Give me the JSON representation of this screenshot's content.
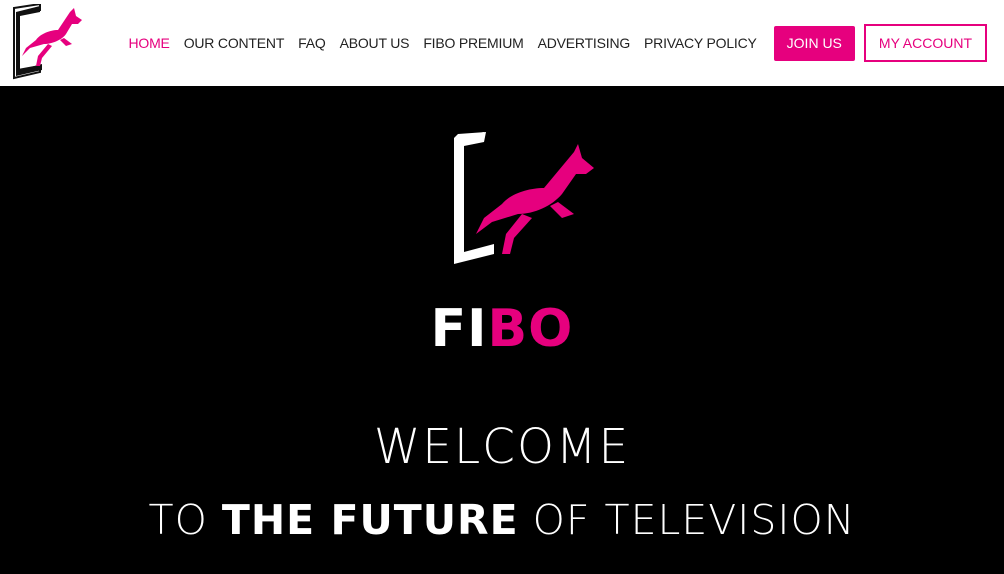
{
  "header": {
    "nav": [
      {
        "label": "HOME",
        "active": true
      },
      {
        "label": "OUR CONTENT"
      },
      {
        "label": "FAQ"
      },
      {
        "label": "ABOUT US"
      },
      {
        "label": "FIBO PREMIUM"
      },
      {
        "label": "ADVERTISING"
      },
      {
        "label": "PRIVACY POLICY"
      }
    ],
    "join_label": "JOIN US",
    "account_label": "MY ACCOUNT"
  },
  "hero": {
    "brand_part1": "FI",
    "brand_part2": "BO",
    "welcome": "WELCOME",
    "tagline_part1": "TO ",
    "tagline_bold": "THE FUTURE",
    "tagline_part2": " OF TELEVISION"
  },
  "colors": {
    "accent": "#e6007e",
    "background": "#000000",
    "header_bg": "#ffffff"
  },
  "icons": {
    "logo": "kangaroo-tv-logo-icon"
  }
}
